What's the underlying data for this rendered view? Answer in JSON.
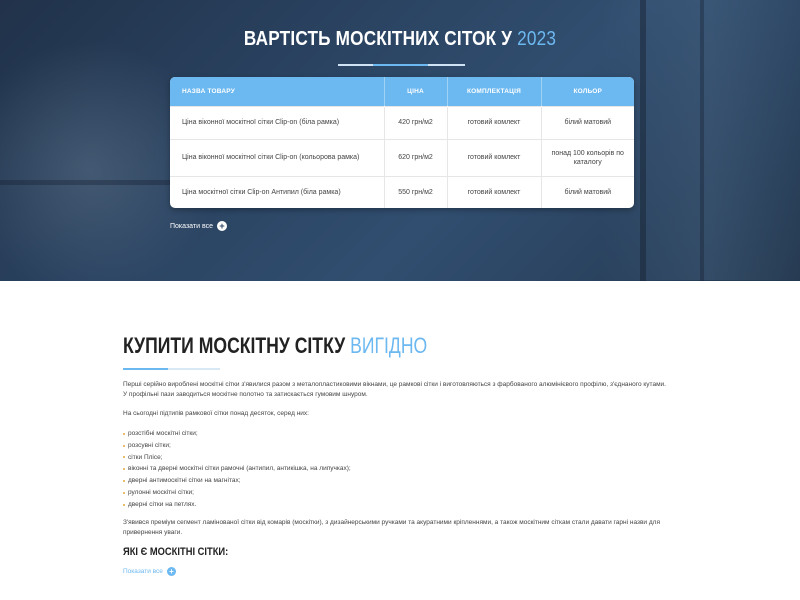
{
  "pricing": {
    "title_main": "ВАРТІСТЬ МОСКІТНИХ СІТОК У",
    "title_accent": "2023",
    "table": {
      "headers": [
        "НАЗВА ТОВАРУ",
        "ЦІНА",
        "КОМПЛЕКТАЦІЯ",
        "КОЛЬОР"
      ],
      "rows": [
        [
          "Ціна віконної москітної сітки Clip-on (біла рамка)",
          "420 грн/м2",
          "готовий комлект",
          "білий матовий"
        ],
        [
          "Ціна віконної москітної сітки Clip-on (кольорова рамка)",
          "620 грн/м2",
          "готовий комлект",
          "понад 100 кольорів по каталогу"
        ],
        [
          "Ціна москітної сітки Clip-on Антипил (біла рамка)",
          "550 грн/м2",
          "готовий комлект",
          "білий матовий"
        ]
      ]
    },
    "show_all": "Показати все"
  },
  "article": {
    "title_main": "КУПИТИ МОСКІТНУ СІТКУ",
    "title_accent": "ВИГІДНО",
    "paragraph1": "Перші серійно вироблені москітні сітки з'явилися разом з металопластиковими вікнами, це рамкові сітки і виготовляються з фарбованого алюмінієвого профілю, з'єднаного кутами. У профільні пази заводиться москітне полотно та затискається гумовим шнуром.",
    "paragraph2": "На сьогодні підтипів рамкової сітки понад десяток, серед них:",
    "list": [
      "розстібні москітні сітки;",
      "розсувні сітки;",
      "сітки Плісе;",
      "віконні та дверні москітні сітки рамочні (антипил, антикішка, на липучках);",
      "дверні антимоскітні сітки на магнітах;",
      "рулонні москітні сітки;",
      "дверні сітки на петлях."
    ],
    "paragraph3": "З'явився преміум сегмент ламінованої сітки від комарів (москітки), з дизайнерськими ручками та акуратними кріпленнями, а також москітним сіткам стали давати гарні назви для привернення уваги.",
    "subheading": "ЯКІ Є МОСКІТНІ СІТКИ:",
    "show_all": "Показати все"
  },
  "colors": {
    "accent": "#6cb8f0",
    "hero_bg": "#2a4361",
    "list_bullet": "#e6a93c"
  },
  "icons": {
    "show_all": "plus-circle-icon"
  }
}
